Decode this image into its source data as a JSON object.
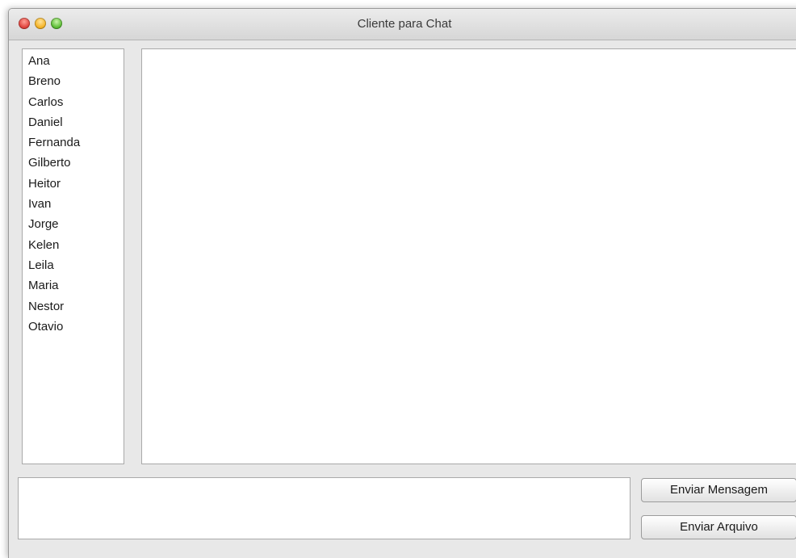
{
  "window": {
    "title": "Cliente para Chat"
  },
  "users": [
    {
      "name": "Ana"
    },
    {
      "name": "Breno"
    },
    {
      "name": "Carlos"
    },
    {
      "name": "Daniel"
    },
    {
      "name": "Fernanda"
    },
    {
      "name": "Gilberto"
    },
    {
      "name": "Heitor"
    },
    {
      "name": "Ivan"
    },
    {
      "name": "Jorge"
    },
    {
      "name": "Kelen"
    },
    {
      "name": "Leila"
    },
    {
      "name": "Maria"
    },
    {
      "name": "Nestor"
    },
    {
      "name": "Otavio"
    }
  ],
  "chat": {
    "messages": ""
  },
  "composer": {
    "value": "",
    "send_message_label": "Enviar Mensagem",
    "send_file_label": "Enviar Arquivo"
  },
  "colors": {
    "close": "#e0443e",
    "minimize": "#f5b427",
    "maximize": "#5dbd36"
  }
}
